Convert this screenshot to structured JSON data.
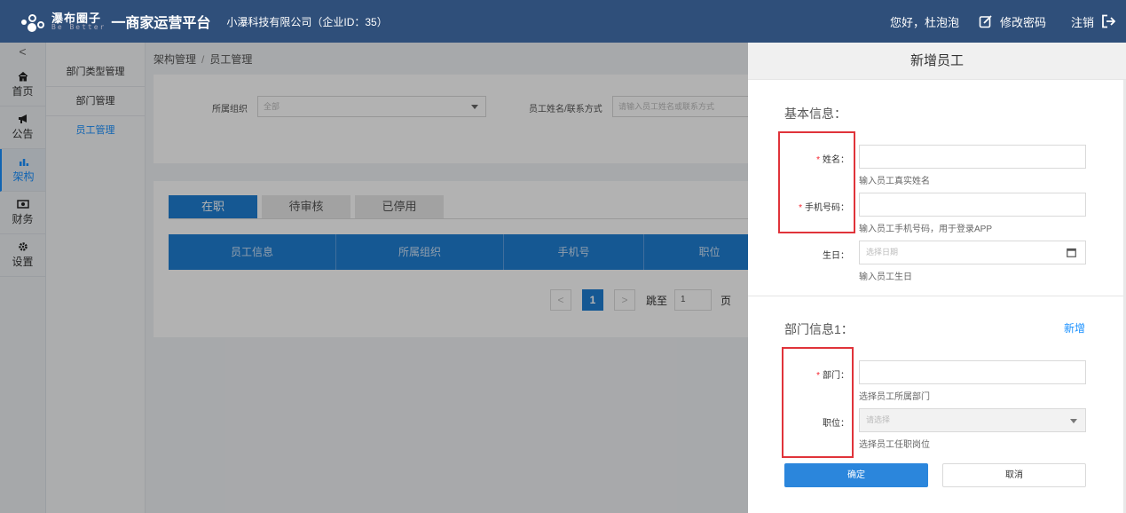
{
  "header": {
    "logo_cn": "瀑布圈子",
    "logo_en": "Be Better",
    "platform": "一商家运营平台",
    "company": "小瀑科技有限公司（企业ID：35）",
    "greeting": "您好，杜泡泡",
    "change_password": "修改密码",
    "logout": "注销"
  },
  "iconnav": {
    "collapse": "<",
    "items": [
      {
        "label": "首页",
        "icon": "home-icon"
      },
      {
        "label": "公告",
        "icon": "megaphone-icon"
      },
      {
        "label": "架构",
        "icon": "bar-chart-icon",
        "active": true
      },
      {
        "label": "财务",
        "icon": "money-icon"
      },
      {
        "label": "设置",
        "icon": "gear-icon"
      }
    ]
  },
  "submenu": {
    "items": [
      {
        "label": "部门类型管理"
      },
      {
        "label": "部门管理"
      },
      {
        "label": "员工管理",
        "active": true
      }
    ]
  },
  "breadcrumb": {
    "parent": "架构管理",
    "separator": "/",
    "current": "员工管理"
  },
  "filter": {
    "org_label": "所属组织",
    "org_value": "全部",
    "search_label": "员工姓名/联系方式",
    "search_placeholder": "请输入员工姓名或联系方式"
  },
  "tabs": [
    {
      "label": "在职",
      "active": true
    },
    {
      "label": "待审核"
    },
    {
      "label": "已停用"
    }
  ],
  "table": {
    "columns": [
      "员工信息",
      "所属组织",
      "手机号",
      "职位"
    ]
  },
  "pagination": {
    "prev": "<",
    "current_page": "1",
    "next": ">",
    "jump_label": "跳至",
    "jump_value": "1",
    "page_unit": "页"
  },
  "drawer": {
    "title": "新增员工",
    "basic_section": "基本信息：",
    "name_label": "姓名：",
    "name_help": "输入员工真实姓名",
    "phone_label": "手机号码：",
    "phone_help": "输入员工手机号码，用于登录APP",
    "birthday_label": "生日：",
    "birthday_placeholder": "选择日期",
    "birthday_help": "输入员工生日",
    "dept_section": "部门信息1：",
    "add_link": "新增",
    "dept_label": "部门：",
    "dept_help": "选择员工所属部门",
    "position_label": "职位：",
    "position_placeholder": "请选择",
    "position_help": "选择员工任职岗位",
    "required_mark": "*",
    "ok": "确定",
    "cancel": "取消"
  },
  "colors": {
    "header_bg": "#2f4f7a",
    "primary": "#1f7fd3",
    "highlight": "#e0333a"
  }
}
